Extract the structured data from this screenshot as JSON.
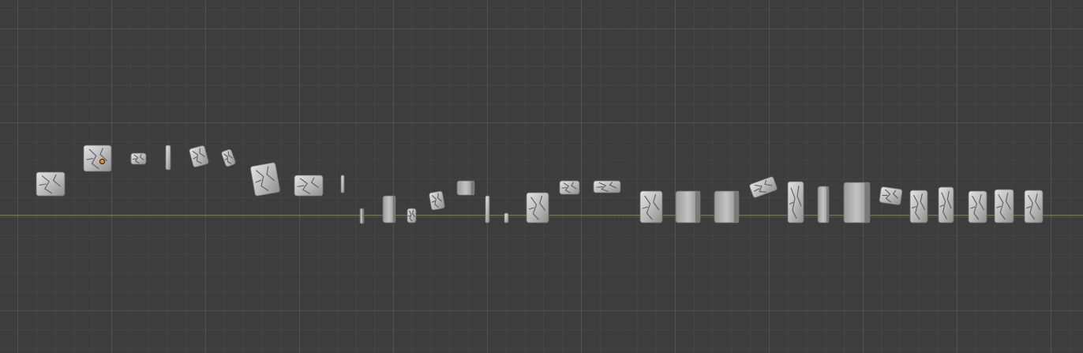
{
  "viewport": {
    "type": "3d-viewport",
    "view": "front-orthographic",
    "background_color": "#3d3d3d",
    "grid_color": "#4a4a4a",
    "axis_color": "#6d8a35",
    "object_color": "#c8c8c8",
    "origin_color": "#e88f1a"
  },
  "scene": {
    "object_kind": "rock-tile-mesh",
    "object_count": 34
  }
}
